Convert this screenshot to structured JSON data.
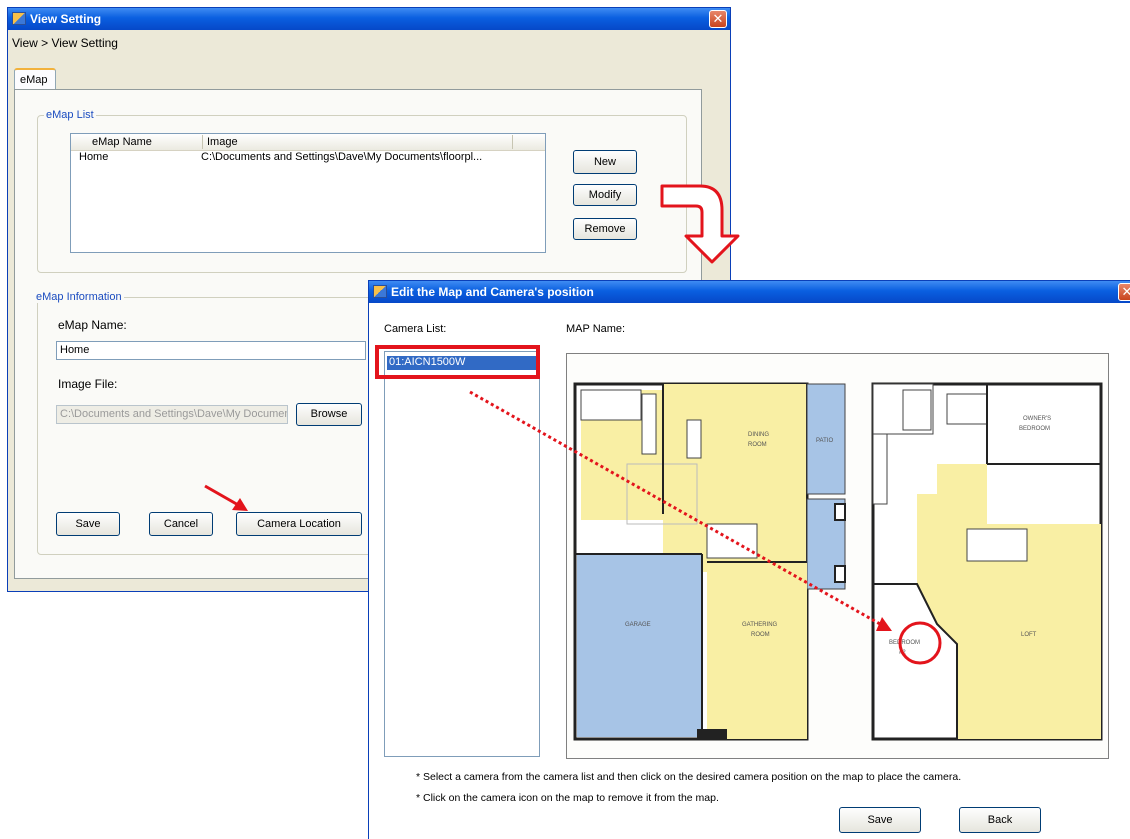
{
  "view_setting": {
    "title": "View Setting",
    "breadcrumb": "View > View Setting",
    "tab": "eMap",
    "emap_list": {
      "legend": "eMap List",
      "columns": [
        "eMap Name",
        "Image"
      ],
      "rows": [
        {
          "name": "Home",
          "image": "C:\\Documents and Settings\\Dave\\My Documents\\floorpl..."
        }
      ],
      "new_label": "New",
      "modify_label": "Modify",
      "remove_label": "Remove"
    },
    "emap_info": {
      "legend": "eMap Information",
      "name_label": "eMap Name:",
      "name_value": "Home",
      "image_label": "Image File:",
      "image_value": "C:\\Documents and Settings\\Dave\\My Documents\\",
      "browse_label": "Browse",
      "save_label": "Save",
      "cancel_label": "Cancel",
      "camera_location_label": "Camera Location"
    }
  },
  "edit_dialog": {
    "title": "Edit the Map and Camera's position",
    "camera_list_label": "Camera List:",
    "map_name_label": "MAP Name:",
    "cameras": [
      "01:AICN1500W"
    ],
    "floorplan_rooms": {
      "dining": "DINING ROOM",
      "patio": "PATIO",
      "owners": "OWNER'S BEDROOM",
      "garage": "GARAGE",
      "gathering": "GATHERING ROOM",
      "loft": "LOFT",
      "bedroom2": "BEDROOM #2"
    },
    "hint_1": "* Select a camera from the camera list and then click on the desired camera position on the map to place the camera.",
    "hint_2": "* Click on the camera icon on the map to remove it from the map.",
    "save_label": "Save",
    "back_label": "Back"
  },
  "colors": {
    "annotation_red": "#e3141c",
    "floor_yellow": "#f9efa4",
    "floor_blue": "#a7c4e6",
    "selection_blue": "#316ac5"
  },
  "icons": {
    "title_icon": "app-window-icon",
    "close": "close-icon"
  }
}
